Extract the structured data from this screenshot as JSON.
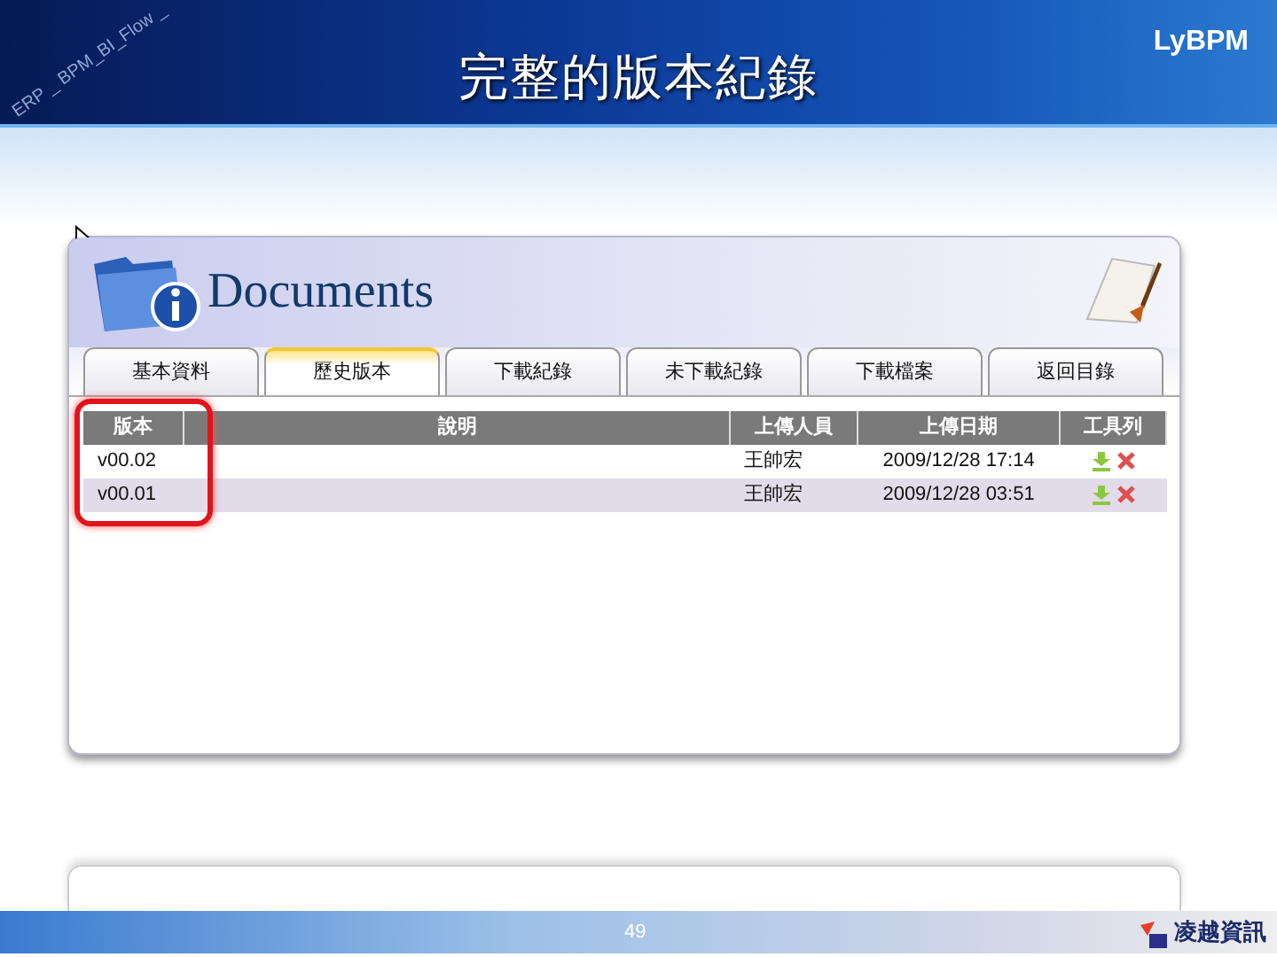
{
  "slide": {
    "banner_text": "ERP _ BPM_BI_Flow _",
    "title": "完整的版本紀錄",
    "brand": "LyBPM"
  },
  "app": {
    "heading": "Documents",
    "tabs": [
      {
        "label": "基本資料",
        "selected": false
      },
      {
        "label": "歷史版本",
        "selected": true
      },
      {
        "label": "下載紀錄",
        "selected": false
      },
      {
        "label": "未下載紀錄",
        "selected": false
      },
      {
        "label": "下載檔案",
        "selected": false
      },
      {
        "label": "返回目錄",
        "selected": false
      }
    ],
    "table": {
      "columns": [
        "版本",
        "說明",
        "上傳人員",
        "上傳日期",
        "工具列"
      ],
      "rows": [
        {
          "version": "v00.02",
          "uploader": "王帥宏",
          "date": "2009/12/28 17:14"
        },
        {
          "version": "v00.01",
          "uploader": "王帥宏",
          "date": "2009/12/28 03:51"
        }
      ]
    }
  },
  "footer": {
    "page_number": "49",
    "company": "凌越資訊"
  }
}
